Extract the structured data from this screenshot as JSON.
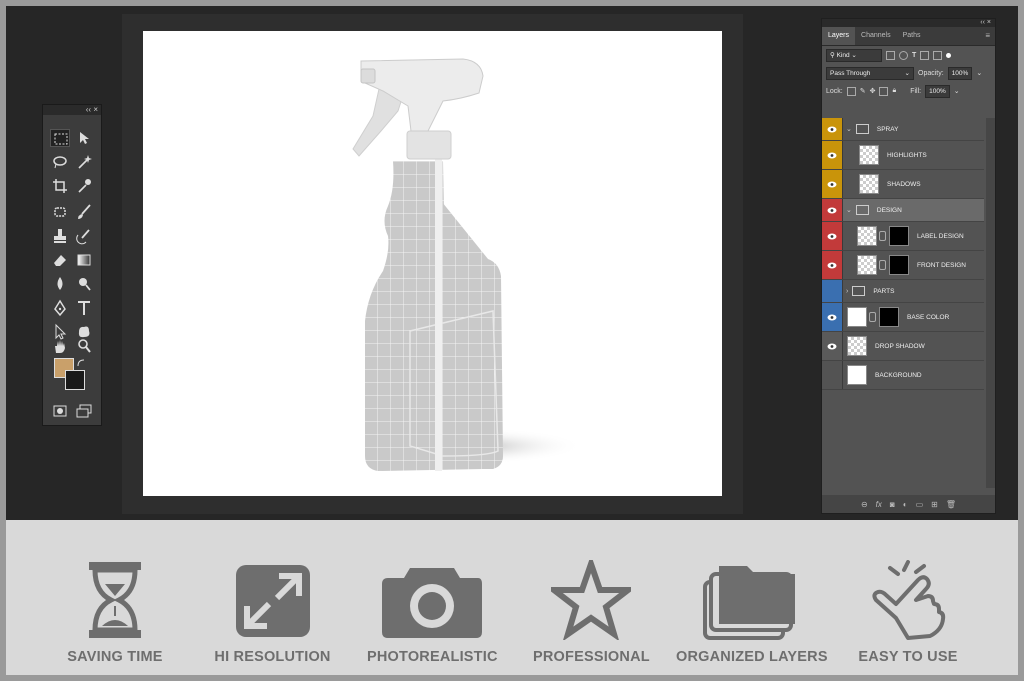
{
  "toolbox": {
    "header": "‹‹ ×"
  },
  "layers_panel": {
    "collapse": "‹‹ ×",
    "tabs": [
      {
        "label": "Layers",
        "active": true
      },
      {
        "label": "Channels",
        "active": false
      },
      {
        "label": "Paths",
        "active": false
      }
    ],
    "filter": "Kind",
    "blend_mode": "Pass Through",
    "opacity_label": "Opacity:",
    "opacity_value": "100%",
    "lock_label": "Lock:",
    "fill_label": "Fill:",
    "fill_value": "100%",
    "layers": [
      {
        "name": "SPRAY",
        "type": "group",
        "color": "#c9940a"
      },
      {
        "name": "HIGHLIGHTS",
        "type": "layer",
        "color": "#c9940a"
      },
      {
        "name": "SHADOWS",
        "type": "layer",
        "color": "#c9940a"
      },
      {
        "name": "DESIGN",
        "type": "group",
        "color": "#c23a3a"
      },
      {
        "name": "LABEL DESIGN",
        "type": "smart",
        "color": "#c23a3a"
      },
      {
        "name": "FRONT DESIGN",
        "type": "smart",
        "color": "#c23a3a"
      },
      {
        "name": "PARTS",
        "type": "group",
        "color": "#3a6fb0"
      },
      {
        "name": "BASE COLOR",
        "type": "smart",
        "color": "#3a6fb0"
      },
      {
        "name": "DROP SHADOW",
        "type": "layer",
        "color": "#5a5a5a"
      },
      {
        "name": "BACKGROUND",
        "type": "layer",
        "color": "#535353"
      }
    ]
  },
  "features": [
    {
      "label": "SAVING TIME",
      "icon": "hourglass-icon"
    },
    {
      "label": "HI RESOLUTION",
      "icon": "expand-icon"
    },
    {
      "label": "PHOTOREALISTIC",
      "icon": "camera-icon"
    },
    {
      "label": "PROFESSIONAL",
      "icon": "star-icon"
    },
    {
      "label": "ORGANIZED LAYERS",
      "icon": "layers-icon"
    },
    {
      "label": "EASY TO USE",
      "icon": "hand-pointer-icon"
    }
  ],
  "colors": {
    "foreground_swatch": "#c9a06a",
    "background_swatch": "#1a1a1a",
    "feature_icon": "#6e6e6e"
  }
}
